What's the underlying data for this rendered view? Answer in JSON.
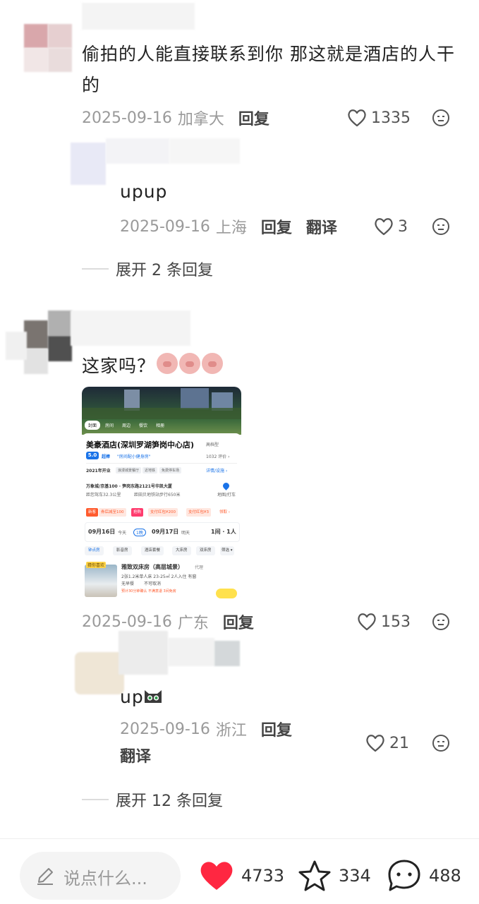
{
  "comments": [
    {
      "text": "偷拍的人能直接联系到你 那这就是酒店的人干的",
      "date": "2025-09-16",
      "location": "加拿大",
      "reply_label": "回复",
      "likes": "1335"
    },
    {
      "text": "upup",
      "date": "2025-09-16",
      "location": "上海",
      "reply_label": "回复",
      "translate_label": "翻译",
      "likes": "3"
    },
    {
      "text": "这家吗？",
      "date": "2025-09-16",
      "location": "广东",
      "reply_label": "回复",
      "likes": "153"
    },
    {
      "text": "up",
      "date": "2025-09-16",
      "location": "浙江",
      "reply_label": "回复",
      "translate_label": "翻译",
      "likes": "21"
    }
  ],
  "expand_replies": [
    "展开 2 条回复",
    "展开 12 条回复"
  ],
  "hotel_card": {
    "tabs": [
      "封面",
      "房间",
      "周边",
      "餐饮",
      "相册"
    ],
    "name": "美豪酒店(深圳罗湖笋岗中心店)",
    "level": "高档型",
    "score": "5.0",
    "score_label": "超棒",
    "quote": "\"房间配小健身房\"",
    "reviews": "1032 评价 ›",
    "opened": "2021年开业",
    "features": [
      "浪漫城景餐厅",
      "近地铁",
      "免费停车场"
    ],
    "details_link": "详情/设施 ›",
    "address": "万象城/京基100 · 笋岗东路2121号华凯大厦",
    "distance_1": "距您驾车32.3公里",
    "distance_2": "距田贝地铁站步行650米",
    "map_label": "地图/打车",
    "coupons": [
      "新客",
      "券后减至100",
      "抢购",
      "支付红包¥200",
      "支付红包¥3",
      "领取 ›"
    ],
    "checkin": "09月16日",
    "checkin_day": "今天",
    "nights": "1晚",
    "checkout": "09月17日",
    "checkout_day": "明天",
    "rooms_guests": "1间 · 1人",
    "filters": [
      "钟点房",
      "影音房",
      "酒店套餐",
      "大床房",
      "双床房",
      "筛选 ▾"
    ],
    "room_badge": "猜你喜欢",
    "room_name": "雅致双床房（高层城景）",
    "room_specs": "2张1.2米单人床  23-25㎡  2人入住  有窗",
    "room_policy_1": "无早餐",
    "room_policy_2": "不可取消",
    "room_note": "预计30分钟确认  不满意退  3间免房",
    "room_tag": "代理"
  },
  "bottom_bar": {
    "input_placeholder": "说点什么...",
    "likes": "4733",
    "favorites": "334",
    "comments": "488",
    "heart_color": "#ff2741"
  }
}
